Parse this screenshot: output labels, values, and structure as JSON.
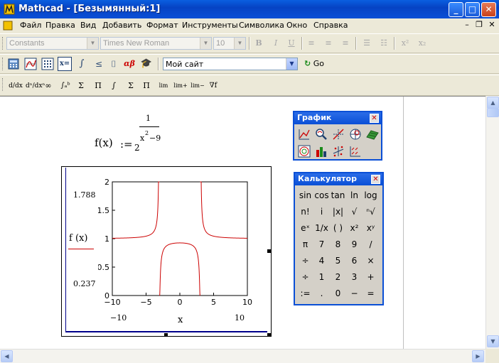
{
  "window": {
    "title": "Mathcad - [Безымянный:1]"
  },
  "menu": [
    "Файл",
    "Правка",
    "Вид",
    "Добавить",
    "Формат",
    "Инструменты",
    "Символика",
    "Окно",
    "Справка"
  ],
  "format_toolbar": {
    "style": "Constants",
    "font": "Times New Roman",
    "size": "10",
    "bold": "B",
    "italic": "I",
    "underline": "U",
    "superscript": "x²",
    "subscript": "x₂"
  },
  "math_toolbar": {
    "resource": "Мой сайт",
    "go": "Go"
  },
  "calc_toolbar": [
    "d/dx",
    "dⁿ/dxⁿ",
    "∞",
    "∫ₐᵇ",
    "Σ",
    "Π",
    "∫",
    "Σ",
    "Π",
    "lim",
    "lim+",
    "lim−",
    "∇f"
  ],
  "formula": {
    "lhs": "f(x)",
    "assign": ":=",
    "base": "2",
    "exp_num": "1",
    "exp_den": "x",
    "exp_den_pow": "2",
    "exp_den_rest": "−9"
  },
  "plot": {
    "ylabel": "f (x)",
    "xlabel": "x",
    "ymax_field": "1.788",
    "ymin_field": "0.237",
    "xmin_field": "−10",
    "xmax_field": "10"
  },
  "chart_data": {
    "type": "line",
    "function": "f(x) = 2^(1/(x^2-9))",
    "series": [
      {
        "name": "f(x)",
        "color": "#cc0000"
      }
    ],
    "xlim": [
      -10,
      10
    ],
    "ylim": [
      0,
      2
    ],
    "xticks": [
      "−10",
      "−5",
      "0",
      "5",
      "10"
    ],
    "yticks": [
      "0",
      "0.5",
      "1",
      "1.5",
      "2"
    ],
    "xlabel": "x",
    "ylabel": "f (x)"
  },
  "graph_palette": {
    "title": "График",
    "close": "✕",
    "icons": [
      "xy-plot-icon",
      "zoom-icon",
      "trace-icon",
      "polar-plot-icon",
      "surface-plot-icon",
      "contour-plot-icon",
      "bar-plot-3d-icon",
      "scatter-plot-3d-icon",
      "vector-field-icon"
    ]
  },
  "calc_palette": {
    "title": "Калькулятор",
    "close": "✕",
    "rows": [
      [
        "sin",
        "cos",
        "tan",
        "ln",
        "log"
      ],
      [
        "n!",
        "i",
        "|x|",
        "√",
        "ⁿ√"
      ],
      [
        "eˣ",
        "1/x",
        "( )",
        "x²",
        "xʸ"
      ],
      [
        "π",
        "7",
        "8",
        "9",
        "/"
      ],
      [
        "÷",
        "4",
        "5",
        "6",
        "×"
      ],
      [
        "÷",
        "1",
        "2",
        "3",
        "+"
      ],
      [
        ":=",
        ".",
        "0",
        "−",
        "="
      ]
    ]
  },
  "colors": {
    "titlebar": "#0a4fd6",
    "curve": "#cc0000",
    "axis_line": "#00008b"
  }
}
